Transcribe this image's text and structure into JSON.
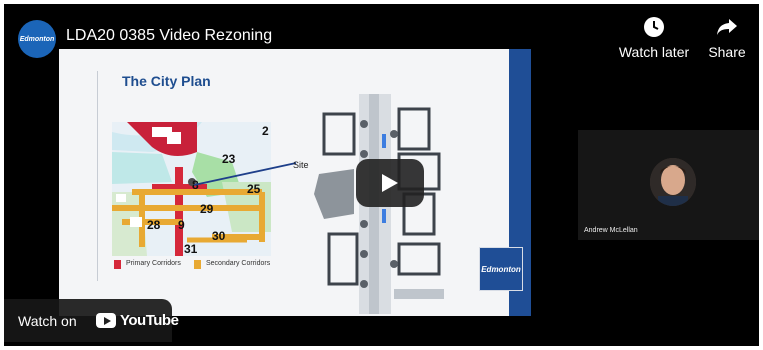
{
  "video": {
    "title": "LDA20 0385 Video Rezoning",
    "channel_logo_text": "Edmonton"
  },
  "actions": {
    "watch_later": "Watch later",
    "share": "Share"
  },
  "slide": {
    "title": "The City Plan",
    "site_label": "Site",
    "map_numbers": [
      "2",
      "23",
      "8",
      "25",
      "29",
      "28",
      "9",
      "30",
      "31"
    ],
    "legend": {
      "primary": "Primary Corridors",
      "secondary": "Secondary Corridors",
      "primary_color": "#d5283a",
      "secondary_color": "#e8a933"
    },
    "logo_text": "Edmonton"
  },
  "presenter": {
    "name": "Andrew McLellan"
  },
  "watch_on": {
    "label": "Watch on",
    "brand": "YouTube"
  }
}
